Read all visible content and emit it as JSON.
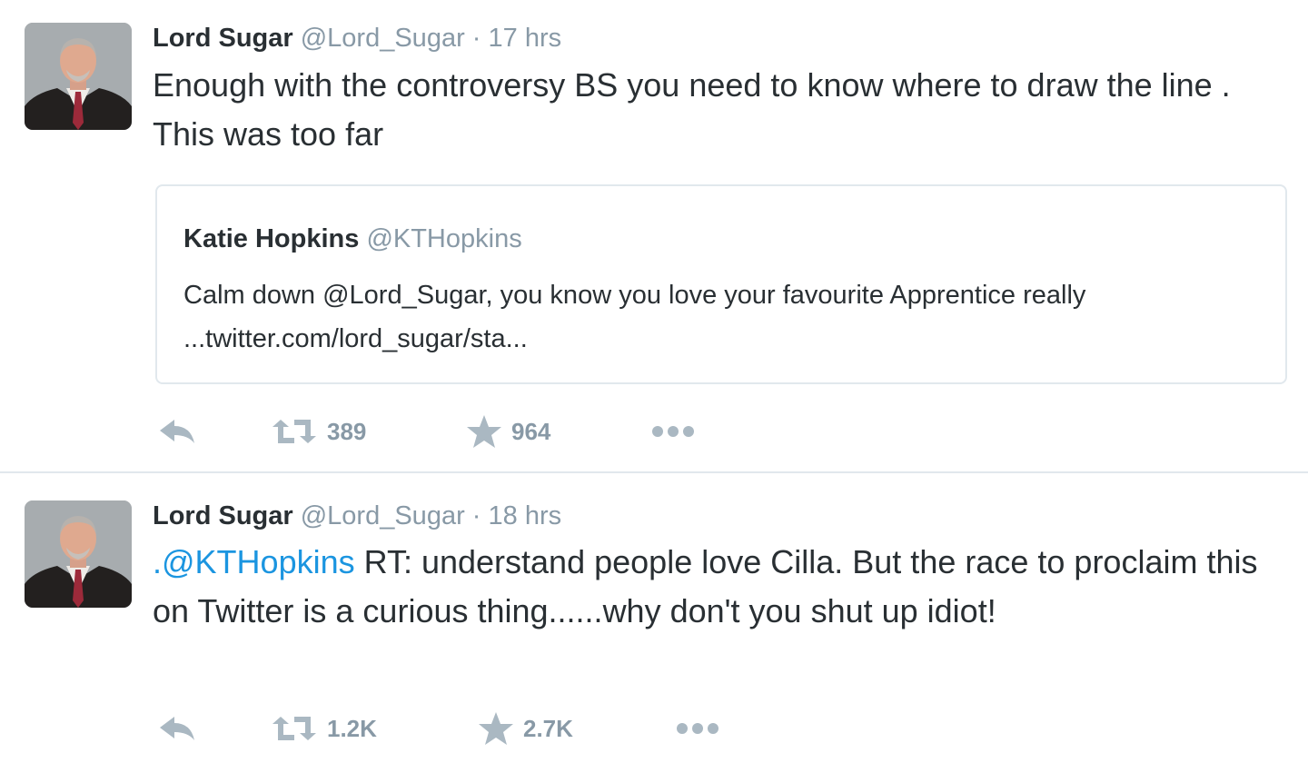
{
  "tweets": [
    {
      "author_name": "Lord Sugar",
      "author_handle": "@Lord_Sugar",
      "separator": "·",
      "timestamp": "17 hrs",
      "text": "Enough with the controversy  BS you need to know where to draw the line . This was too far",
      "quoted_tweet": {
        "author_name": "Katie Hopkins",
        "author_handle": "@KTHopkins",
        "text": "Calm down @Lord_Sugar, you know you love your favourite Apprentice really ...twitter.com/lord_sugar/sta..."
      },
      "retweets": "389",
      "likes": "964"
    },
    {
      "author_name": "Lord Sugar",
      "author_handle": "@Lord_Sugar",
      "separator": "·",
      "timestamp": "18 hrs",
      "text_mention": ".@KTHopkins",
      "text": " RT:  understand people love Cilla. But the race to proclaim this on Twitter is a curious thing......why don't you shut up idiot!",
      "retweets": "1.2K",
      "likes": "2.7K"
    }
  ],
  "icons": {
    "reply": "reply-icon",
    "retweet": "retweet-icon",
    "like": "star-icon",
    "more": "more-icon"
  },
  "colors": {
    "text": "#292f33",
    "muted": "#8899a6",
    "mention": "#1b95e0",
    "icon": "#aab8c2",
    "border": "#e1e8ed"
  }
}
